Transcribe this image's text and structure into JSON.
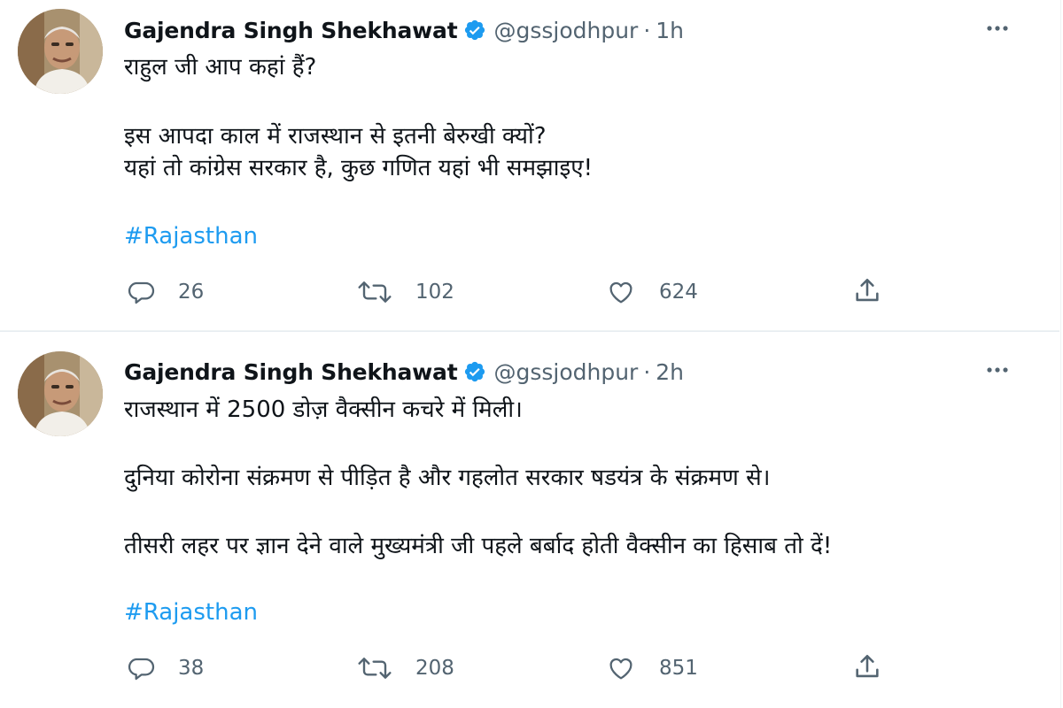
{
  "tweets": [
    {
      "author": {
        "name": "Gajendra Singh Shekhawat",
        "handle": "@gssjodhpur",
        "verified": true
      },
      "separator": "·",
      "time": "1h",
      "lines": [
        "राहुल जी आप कहां हैं?",
        "इस आपदा काल में राजस्थान से इतनी बेरुखी क्यों?",
        "यहां तो कांग्रेस सरकार है, कुछ गणित यहां भी समझाइए!"
      ],
      "hashtag": "#Rajasthan",
      "stats": {
        "replies": "26",
        "retweets": "102",
        "likes": "624"
      }
    },
    {
      "author": {
        "name": "Gajendra Singh Shekhawat",
        "handle": "@gssjodhpur",
        "verified": true
      },
      "separator": "·",
      "time": "2h",
      "lines": [
        "राजस्थान में 2500 डोज़ वैक्सीन कचरे में मिली।",
        "दुनिया कोरोना संक्रमण से पीड़ित है और गहलोत सरकार षडयंत्र के संक्रमण से।",
        "तीसरी लहर पर ज्ञान देने वाले मुख्यमंत्री जी पहले बर्बाद होती वैक्सीन का हिसाब तो दें!"
      ],
      "hashtag": "#Rajasthan",
      "stats": {
        "replies": "38",
        "retweets": "208",
        "likes": "851"
      }
    }
  ],
  "icons": {
    "verified": "verified-badge-icon",
    "more": "more-options-icon",
    "reply": "reply-icon",
    "retweet": "retweet-icon",
    "like": "like-icon",
    "share": "share-icon"
  },
  "colors": {
    "verified_blue": "#1d9bf0",
    "hashtag_blue": "#1d9bf0",
    "muted_gray": "#536471",
    "text": "#0f1419"
  }
}
